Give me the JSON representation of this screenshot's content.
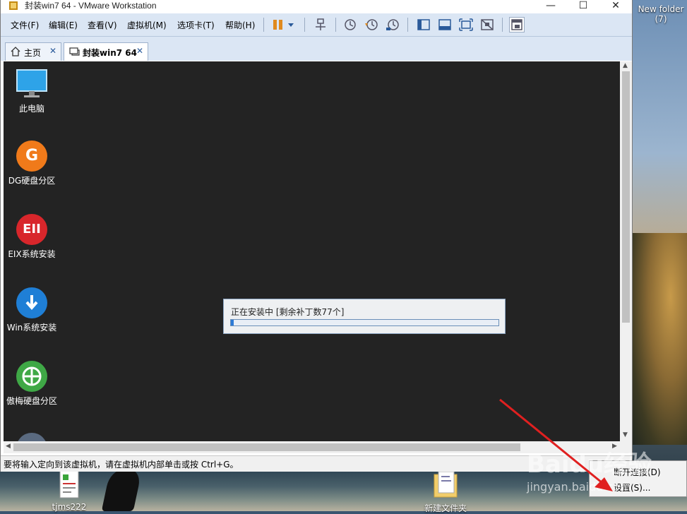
{
  "window": {
    "title": "封装win7 64 - VMware Workstation",
    "minimize": "—",
    "maximize": "☐",
    "close": "✕"
  },
  "menu": {
    "items": [
      {
        "label": "文件(F)"
      },
      {
        "label": "编辑(E)"
      },
      {
        "label": "查看(V)"
      },
      {
        "label": "虚拟机(M)"
      },
      {
        "label": "选项卡(T)"
      },
      {
        "label": "帮助(H)"
      }
    ]
  },
  "tabs": [
    {
      "label": "主页",
      "close": "✕"
    },
    {
      "label": "封装win7 64",
      "close": "✕"
    }
  ],
  "vm_desktop": {
    "icons": [
      {
        "label": "此电脑",
        "icon": "computer-icon"
      },
      {
        "label": "DG硬盘分区",
        "icon": "dg-icon"
      },
      {
        "label": "EIX系统安装",
        "icon": "eix-icon"
      },
      {
        "label": "Win系统安装",
        "icon": "download-icon"
      },
      {
        "label": "傲梅硬盘分区",
        "icon": "partition-icon"
      }
    ],
    "dialog": {
      "text": "正在安装中 [剩余补丁数77个]",
      "progress": 0.01
    }
  },
  "status": {
    "text": "要将输入定向到该虚拟机，请在虚拟机内部单击或按 Ctrl+G。"
  },
  "host_desktop": {
    "folder_label": "New folder",
    "folder_count": "(7)",
    "icons": [
      {
        "label": "tjms222"
      },
      {
        "label": "新建文件夹"
      }
    ]
  },
  "context_menu": {
    "items": [
      {
        "label": "断开连接(D)"
      },
      {
        "label": "设置(S)..."
      }
    ]
  },
  "watermark": {
    "brand": "Baidu经验",
    "url": "jingyan.baidu.com"
  },
  "colors": {
    "menubar": "#dbe6f4",
    "vm_background": "#232323",
    "progress": "#2c7ad6",
    "arrow": "#e02020"
  }
}
